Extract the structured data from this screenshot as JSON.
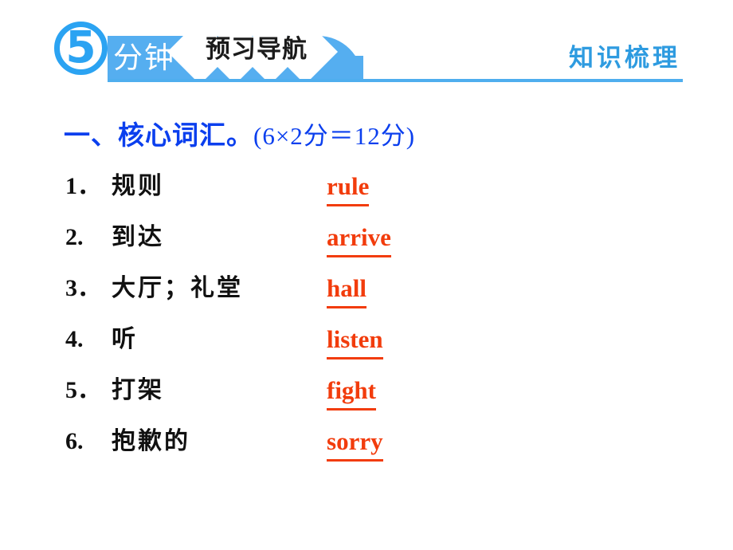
{
  "header": {
    "minutes_badge": "5",
    "minutes_label": "分钟",
    "chip_label": "预习导航",
    "section_title": "知识梳理",
    "accent_blue": "#55AEF0",
    "title_blue": "#2E9BE0",
    "rule_color": "#4FAEEE"
  },
  "content": {
    "title_main": "一、核心词汇。",
    "title_score": "(6×2分＝12分)",
    "title_color": "#0B3FEE",
    "answer_color": "#F23C0C",
    "items": [
      {
        "num": "1．",
        "cn": "规则",
        "en": "rule"
      },
      {
        "num": "2.",
        "cn": "到达",
        "en": "arrive"
      },
      {
        "num": "3．",
        "cn": "大厅；礼堂",
        "en": "hall"
      },
      {
        "num": "4.",
        "cn": "听",
        "en": "listen"
      },
      {
        "num": "5．",
        "cn": "打架",
        "en": "fight"
      },
      {
        "num": "6.",
        "cn": "抱歉的",
        "en": "sorry"
      }
    ]
  }
}
